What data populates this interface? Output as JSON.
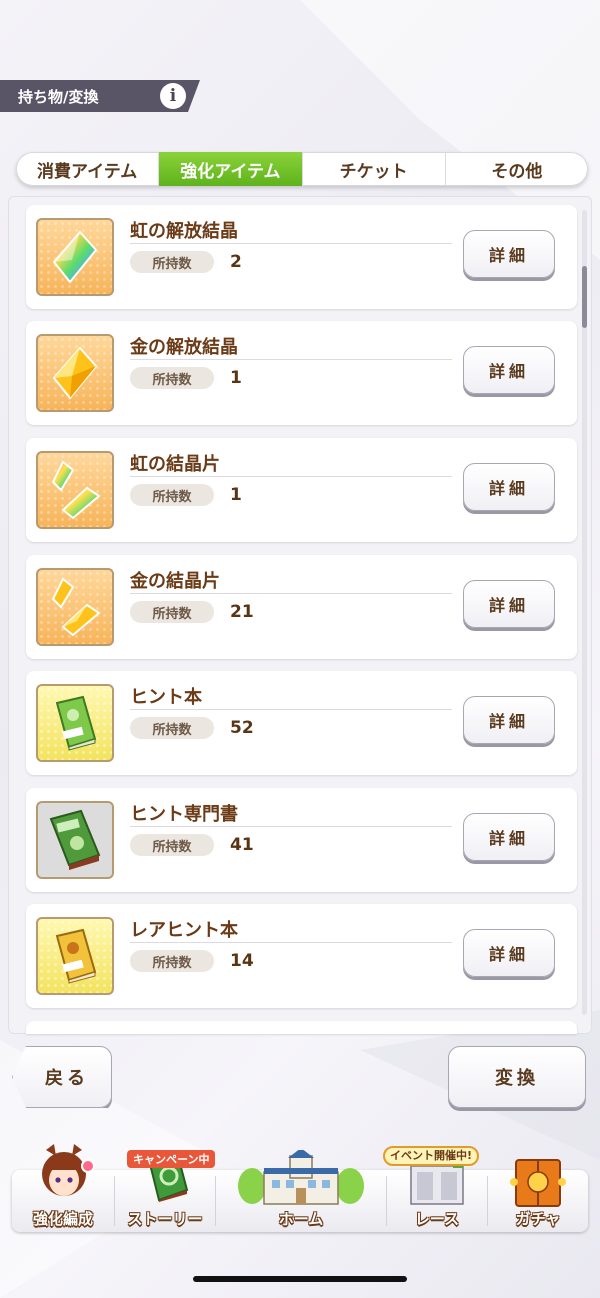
{
  "header": {
    "title": "持ち物/変換",
    "info_symbol": "i"
  },
  "tabs": [
    {
      "label": "消費アイテム",
      "active": false
    },
    {
      "label": "強化アイテム",
      "active": true
    },
    {
      "label": "チケット",
      "active": false
    },
    {
      "label": "その他",
      "active": false
    }
  ],
  "items": [
    {
      "name": "虹の解放結晶",
      "count_label": "所持数",
      "count": "2",
      "detail": "詳細",
      "icon": "rainbow-crystal-icon",
      "bg": "orange"
    },
    {
      "name": "金の解放結晶",
      "count_label": "所持数",
      "count": "1",
      "detail": "詳細",
      "icon": "gold-crystal-icon",
      "bg": "orange"
    },
    {
      "name": "虹の結晶片",
      "count_label": "所持数",
      "count": "1",
      "detail": "詳細",
      "icon": "rainbow-shards-icon",
      "bg": "orange"
    },
    {
      "name": "金の結晶片",
      "count_label": "所持数",
      "count": "21",
      "detail": "詳細",
      "icon": "gold-shards-icon",
      "bg": "orange"
    },
    {
      "name": "ヒント本",
      "count_label": "所持数",
      "count": "52",
      "detail": "詳細",
      "icon": "hint-book-icon",
      "bg": "yellow"
    },
    {
      "name": "ヒント専門書",
      "count_label": "所持数",
      "count": "41",
      "detail": "詳細",
      "icon": "hint-specialist-book-icon",
      "bg": "yellow"
    },
    {
      "name": "レアヒント本",
      "count_label": "所持数",
      "count": "14",
      "detail": "詳細",
      "icon": "rare-hint-book-icon",
      "bg": "yellow"
    }
  ],
  "footer": {
    "back_label": "戻る",
    "convert_label": "変換"
  },
  "nav": {
    "items": [
      {
        "label": "強化編成",
        "icon": "character-portrait-icon"
      },
      {
        "label": "ストーリー",
        "icon": "story-book-icon",
        "badge": "キャンペーン中"
      },
      {
        "label": "ホーム",
        "icon": "school-building-icon"
      },
      {
        "label": "レース",
        "icon": "race-gate-icon",
        "badge": "イベント開催中!"
      },
      {
        "label": "ガチャ",
        "icon": "gacha-door-icon"
      }
    ]
  },
  "colors": {
    "active_tab": "#6cc024",
    "text_brown": "#6b3a16",
    "title_bar": "#5a5566"
  }
}
